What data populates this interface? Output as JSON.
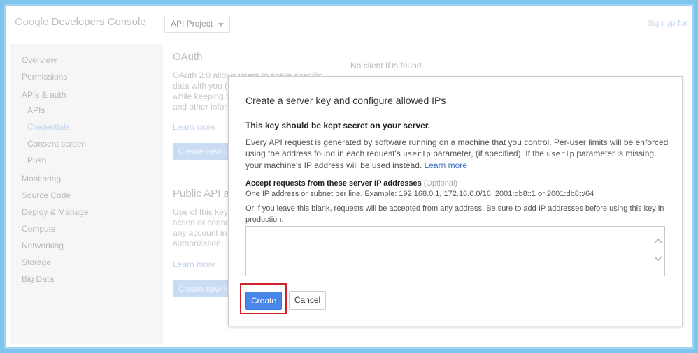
{
  "header": {
    "logo_google": "Google",
    "logo_product": "Developers Console",
    "project": "API Project",
    "signup": "Sign up for"
  },
  "sidebar": {
    "items": [
      {
        "label": "Overview",
        "indent": false,
        "active": false
      },
      {
        "label": "Permissions",
        "indent": false,
        "active": false
      },
      {
        "label": "APIs & auth",
        "indent": false,
        "active": false
      },
      {
        "label": "APIs",
        "indent": true,
        "active": false
      },
      {
        "label": "Credentials",
        "indent": true,
        "active": true
      },
      {
        "label": "Consent screen",
        "indent": true,
        "active": false
      },
      {
        "label": "Push",
        "indent": true,
        "active": false
      },
      {
        "label": "Monitoring",
        "indent": false,
        "active": false
      },
      {
        "label": "Source Code",
        "indent": false,
        "active": false
      },
      {
        "label": "Deploy & Manage",
        "indent": false,
        "active": false
      },
      {
        "label": "Compute",
        "indent": false,
        "active": false
      },
      {
        "label": "Networking",
        "indent": false,
        "active": false
      },
      {
        "label": "Storage",
        "indent": false,
        "active": false
      },
      {
        "label": "Big Data",
        "indent": false,
        "active": false
      }
    ]
  },
  "main": {
    "oauth": {
      "title": "OAuth",
      "text": [
        "OAuth 2.0 allows users to share specific",
        "data with you (",
        "while keeping t",
        "and other infor"
      ],
      "learn_more": "Learn more",
      "button": "Create new C"
    },
    "public_api": {
      "title": "Public API ac",
      "text": [
        "Use of this key",
        "action or conse",
        "any account in",
        "authorization."
      ],
      "learn_more": "Learn more",
      "button": "Create new K"
    },
    "no_clients": "No client IDs found."
  },
  "dialog": {
    "title": "Create a server key and configure allowed IPs",
    "warning": "This key should be kept secret on your server.",
    "para_1": "Every API request is generated by software running on a machine that you control. Per-user limits will be enforced using the address found in each request's ",
    "code_1": "userIp",
    "para_2": " parameter, (if specified). If the ",
    "code_2": "userIp",
    "para_3": " parameter is missing, your machine's IP address will be used instead. ",
    "learn_more": "Learn more",
    "accept_label": "Accept requests from these server IP addresses",
    "optional": "(Optional)",
    "hint_1": "One IP address or subnet per line. Example: 192.168.0.1, 172.16.0.0/16, 2001:db8::1 or 2001:db8::/64",
    "hint_2": "Or if you leave this blank, requests will be accepted from any address. Be sure to add IP addresses before using this key in production.",
    "ip_value": "",
    "create_label": "Create",
    "cancel_label": "Cancel"
  },
  "colors": {
    "accent": "#4a86e8",
    "highlight_box": "#d0222b",
    "frame": "#7fc4ec"
  }
}
